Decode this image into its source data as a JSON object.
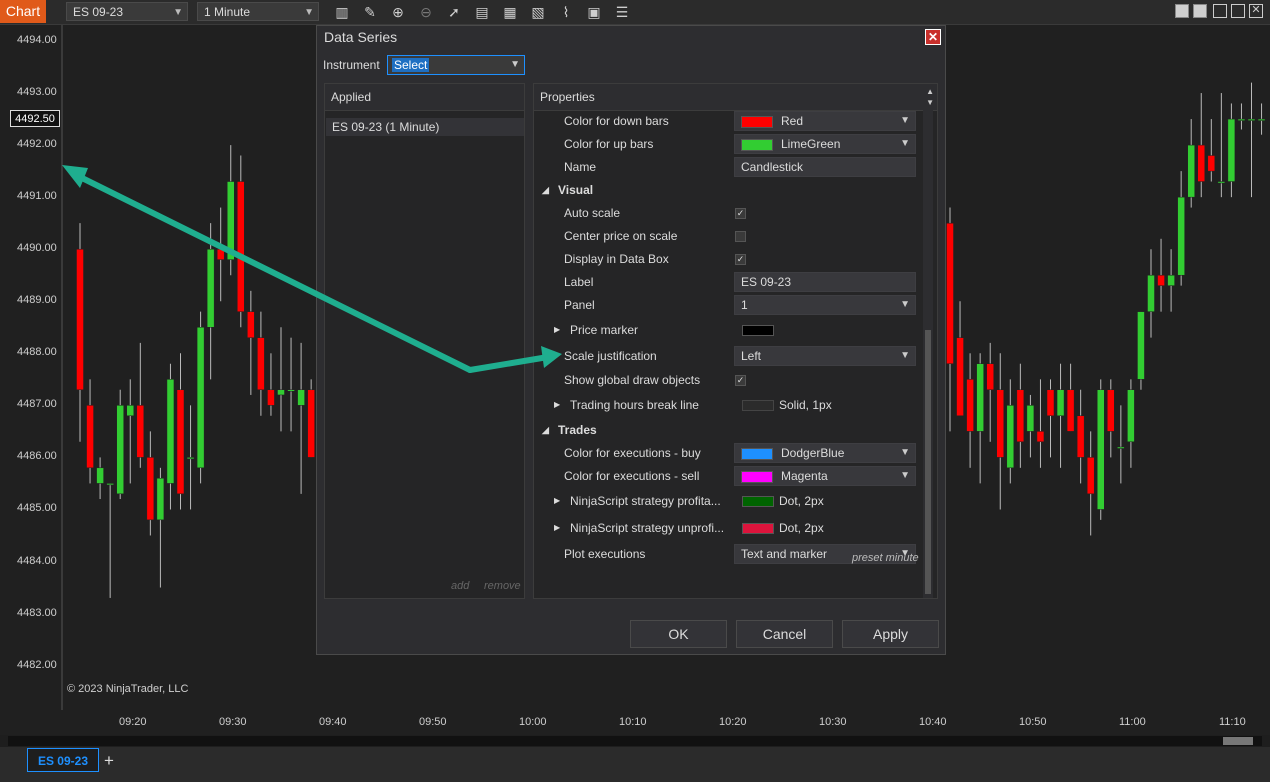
{
  "toolbar": {
    "chart_label": "Chart",
    "instrument": "ES 09-23",
    "interval": "1 Minute",
    "icons": [
      "bars-icon",
      "pencil-icon",
      "zoom-in-icon",
      "zoom-out-icon",
      "pointer-icon",
      "data-series-icon",
      "strategies-icon",
      "indicators-icon",
      "drawing-tools-icon",
      "properties-icon",
      "list-icon"
    ]
  },
  "chart": {
    "price_labels": [
      "4494.00",
      "4493.00",
      "4492.00",
      "4491.00",
      "4490.00",
      "4489.00",
      "4488.00",
      "4487.00",
      "4486.00",
      "4485.00",
      "4484.00",
      "4483.00",
      "4482.00"
    ],
    "current_price": "4492.50",
    "time_labels": [
      "09:20",
      "09:30",
      "09:40",
      "09:50",
      "10:00",
      "10:10",
      "10:20",
      "10:30",
      "10:40",
      "10:50",
      "11:00",
      "11:10"
    ],
    "copyright": "© 2023 NinjaTrader, LLC",
    "up_color": "#32cd32",
    "down_color": "#ff0000",
    "arrow_color": "#1fae8f"
  },
  "chart_data": {
    "type": "candlestick",
    "ylim": [
      4481.5,
      4494.5
    ],
    "left_bars": [
      {
        "o": 4490.0,
        "h": 4490.5,
        "l": 4486.3,
        "c": 4487.3
      },
      {
        "o": 4487.0,
        "h": 4487.5,
        "l": 4485.5,
        "c": 4485.8
      },
      {
        "o": 4485.5,
        "h": 4486.0,
        "l": 4485.2,
        "c": 4485.8
      },
      {
        "o": 4485.5,
        "h": 4485.5,
        "l": 4483.3,
        "c": 4485.5
      },
      {
        "o": 4485.3,
        "h": 4487.3,
        "l": 4485.2,
        "c": 4487.0
      },
      {
        "o": 4486.8,
        "h": 4487.5,
        "l": 4485.5,
        "c": 4487.0
      },
      {
        "o": 4487.0,
        "h": 4488.2,
        "l": 4485.8,
        "c": 4486.0
      },
      {
        "o": 4486.0,
        "h": 4486.5,
        "l": 4484.5,
        "c": 4484.8
      },
      {
        "o": 4484.8,
        "h": 4485.8,
        "l": 4483.5,
        "c": 4485.6
      },
      {
        "o": 4485.5,
        "h": 4487.8,
        "l": 4485.0,
        "c": 4487.5
      },
      {
        "o": 4487.3,
        "h": 4488.0,
        "l": 4485.0,
        "c": 4485.3
      },
      {
        "o": 4486.0,
        "h": 4487.0,
        "l": 4485.0,
        "c": 4486.0
      },
      {
        "o": 4485.8,
        "h": 4488.8,
        "l": 4485.5,
        "c": 4488.5
      },
      {
        "o": 4488.5,
        "h": 4490.5,
        "l": 4487.5,
        "c": 4490.0
      },
      {
        "o": 4490.0,
        "h": 4490.8,
        "l": 4489.0,
        "c": 4489.8
      },
      {
        "o": 4489.8,
        "h": 4492.0,
        "l": 4489.5,
        "c": 4491.3
      },
      {
        "o": 4491.3,
        "h": 4491.8,
        "l": 4488.5,
        "c": 4488.8
      },
      {
        "o": 4488.8,
        "h": 4489.2,
        "l": 4487.2,
        "c": 4488.3
      },
      {
        "o": 4488.3,
        "h": 4488.8,
        "l": 4486.8,
        "c": 4487.3
      },
      {
        "o": 4487.3,
        "h": 4488.0,
        "l": 4486.8,
        "c": 4487.0
      },
      {
        "o": 4487.2,
        "h": 4488.5,
        "l": 4486.5,
        "c": 4487.3
      },
      {
        "o": 4487.3,
        "h": 4488.3,
        "l": 4486.5,
        "c": 4487.3
      },
      {
        "o": 4487.0,
        "h": 4488.2,
        "l": 4485.3,
        "c": 4487.3
      },
      {
        "o": 4487.3,
        "h": 4487.5,
        "l": 4486.0,
        "c": 4486.0
      }
    ],
    "right_bars": [
      {
        "o": 4490.5,
        "h": 4490.8,
        "l": 4486.5,
        "c": 4487.8
      },
      {
        "o": 4488.3,
        "h": 4489.0,
        "l": 4486.8,
        "c": 4486.8
      },
      {
        "o": 4487.5,
        "h": 4488.0,
        "l": 4485.8,
        "c": 4486.5
      },
      {
        "o": 4486.5,
        "h": 4488.0,
        "l": 4485.5,
        "c": 4487.8
      },
      {
        "o": 4487.8,
        "h": 4488.2,
        "l": 4486.3,
        "c": 4487.3
      },
      {
        "o": 4487.3,
        "h": 4488.0,
        "l": 4485.0,
        "c": 4486.0
      },
      {
        "o": 4485.8,
        "h": 4487.5,
        "l": 4485.5,
        "c": 4487.0
      },
      {
        "o": 4487.3,
        "h": 4487.8,
        "l": 4485.8,
        "c": 4486.3
      },
      {
        "o": 4486.5,
        "h": 4487.2,
        "l": 4486.0,
        "c": 4487.0
      },
      {
        "o": 4486.5,
        "h": 4487.5,
        "l": 4485.8,
        "c": 4486.3
      },
      {
        "o": 4487.3,
        "h": 4487.5,
        "l": 4486.0,
        "c": 4486.8
      },
      {
        "o": 4486.8,
        "h": 4487.8,
        "l": 4485.8,
        "c": 4487.3
      },
      {
        "o": 4487.3,
        "h": 4487.8,
        "l": 4486.5,
        "c": 4486.5
      },
      {
        "o": 4486.8,
        "h": 4487.3,
        "l": 4485.5,
        "c": 4486.0
      },
      {
        "o": 4486.0,
        "h": 4486.5,
        "l": 4484.5,
        "c": 4485.3
      },
      {
        "o": 4485.0,
        "h": 4487.5,
        "l": 4484.8,
        "c": 4487.3
      },
      {
        "o": 4487.3,
        "h": 4487.5,
        "l": 4486.0,
        "c": 4486.5
      },
      {
        "o": 4486.2,
        "h": 4487.0,
        "l": 4485.5,
        "c": 4486.2
      },
      {
        "o": 4486.3,
        "h": 4487.5,
        "l": 4485.8,
        "c": 4487.3
      },
      {
        "o": 4487.5,
        "h": 4488.8,
        "l": 4487.3,
        "c": 4488.8
      },
      {
        "o": 4488.8,
        "h": 4490.0,
        "l": 4488.3,
        "c": 4489.5
      },
      {
        "o": 4489.5,
        "h": 4490.2,
        "l": 4488.8,
        "c": 4489.3
      },
      {
        "o": 4489.3,
        "h": 4490.0,
        "l": 4488.8,
        "c": 4489.5
      },
      {
        "o": 4489.5,
        "h": 4491.5,
        "l": 4489.3,
        "c": 4491.0
      },
      {
        "o": 4491.0,
        "h": 4492.5,
        "l": 4490.8,
        "c": 4492.0
      },
      {
        "o": 4492.0,
        "h": 4493.0,
        "l": 4491.0,
        "c": 4491.3
      },
      {
        "o": 4491.8,
        "h": 4492.5,
        "l": 4491.3,
        "c": 4491.5
      },
      {
        "o": 4491.3,
        "h": 4493.0,
        "l": 4491.0,
        "c": 4491.3
      },
      {
        "o": 4491.3,
        "h": 4492.8,
        "l": 4491.0,
        "c": 4492.5
      },
      {
        "o": 4492.5,
        "h": 4492.8,
        "l": 4492.3,
        "c": 4492.5
      },
      {
        "o": 4492.5,
        "h": 4493.2,
        "l": 4491.0,
        "c": 4492.5
      },
      {
        "o": 4492.5,
        "h": 4492.8,
        "l": 4492.2,
        "c": 4492.5
      }
    ]
  },
  "dialog": {
    "title": "Data Series",
    "instrument_label": "Instrument",
    "instrument_value": "Select",
    "applied_header": "Applied",
    "applied_item": "ES 09-23 (1 Minute)",
    "add_label": "add",
    "remove_label": "remove",
    "properties_header": "Properties",
    "preset": "preset minute",
    "ok": "OK",
    "cancel": "Cancel",
    "apply": "Apply",
    "properties": {
      "down_bars": {
        "label": "Color for down bars",
        "value": "Red",
        "color": "#ff0000"
      },
      "up_bars": {
        "label": "Color for up bars",
        "value": "LimeGreen",
        "color": "#32cd32"
      },
      "name": {
        "label": "Name",
        "value": "Candlestick"
      },
      "visual_section": "Visual",
      "auto_scale": {
        "label": "Auto scale",
        "checked": true
      },
      "center_price": {
        "label": "Center price on scale",
        "checked": false
      },
      "display_data_box": {
        "label": "Display in Data Box",
        "checked": true
      },
      "label": {
        "label": "Label",
        "value": "ES 09-23"
      },
      "panel": {
        "label": "Panel",
        "value": "1"
      },
      "price_marker": {
        "label": "Price marker",
        "color": "#000000"
      },
      "scale_justification": {
        "label": "Scale justification",
        "value": "Left"
      },
      "show_global_draw": {
        "label": "Show global draw objects",
        "checked": true
      },
      "trading_hours": {
        "label": "Trading hours break line",
        "value": "Solid, 1px",
        "color": "#2b2b2b"
      },
      "trades_section": "Trades",
      "exec_buy": {
        "label": "Color for executions - buy",
        "value": "DodgerBlue",
        "color": "#1e90ff"
      },
      "exec_sell": {
        "label": "Color for executions - sell",
        "value": "Magenta",
        "color": "#ff00ff"
      },
      "strategy_profit": {
        "label": "NinjaScript strategy profita...",
        "value": "Dot, 2px",
        "color": "#006400"
      },
      "strategy_unprofit": {
        "label": "NinjaScript strategy unprofi...",
        "value": "Dot, 2px",
        "color": "#dc143c"
      },
      "plot_executions": {
        "label": "Plot executions",
        "value": "Text and marker"
      }
    }
  },
  "bottom": {
    "series_tab": "ES 09-23",
    "add_tab": "+"
  }
}
